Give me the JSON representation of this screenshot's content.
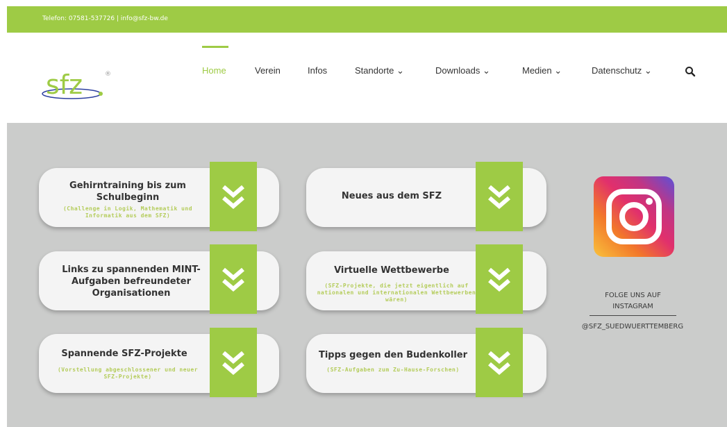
{
  "topbar": {
    "contact": "Telefon: 07581-537726  |  info@sfz-bw.de"
  },
  "logo": {
    "text": "sfz",
    "mark": "®"
  },
  "nav": {
    "home": "Home",
    "verein": "Verein",
    "infos": "Infos",
    "standorte": "Standorte",
    "downloads": "Downloads",
    "medien": "Medien",
    "datenschutz": "Datenschutz"
  },
  "cards": [
    {
      "title": "Gehirntraining  bis zum Schulbeginn",
      "sub": "(Challenge in Logik, Mathematik und Informatik aus dem SFZ)"
    },
    {
      "title": "Neues aus dem SFZ",
      "sub": ""
    },
    {
      "title": "Links zu spannenden MINT-Aufgaben befreundeter Organisationen",
      "sub": ""
    },
    {
      "title": "Virtuelle Wettbewerbe",
      "sub": "(SFZ-Projekte, die jetzt eigentlich auf nationalen und internationalen Wettbewerben wären)"
    },
    {
      "title": "Spannende SFZ-Projekte",
      "sub": "(Vorstellung abgeschlossener und neuer SFZ-Projekte)"
    },
    {
      "title": "Tipps gegen den Budenkoller",
      "sub": "(SFZ-Aufgaben zum Zu-Hause-Forschen)"
    }
  ],
  "instagram": {
    "line1": "FOLGE UNS AUF",
    "line2": "INSTAGRAM",
    "handle": "@SFZ_SUEDWUERTTEMBERG"
  },
  "colors": {
    "brand_green": "#9ecb45",
    "background_grey": "#cbcccb"
  }
}
